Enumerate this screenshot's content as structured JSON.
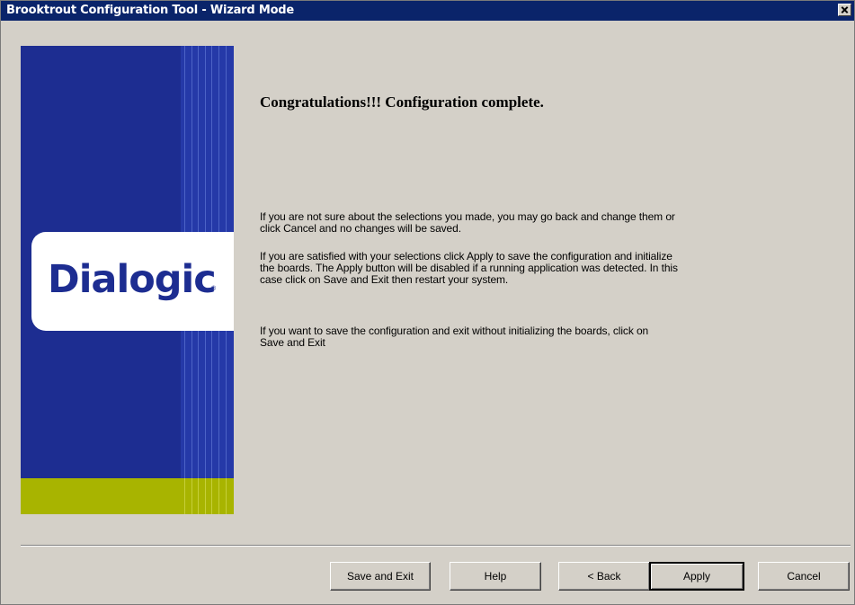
{
  "window": {
    "title": "Brooktrout Configuration Tool - Wizard Mode"
  },
  "brand": {
    "logo_text": "Dialogic",
    "registered_mark": "®"
  },
  "content": {
    "heading": "Congratulations!!! Configuration complete.",
    "paragraphs": [
      "If you are not sure about the selections you made, you may go back and change them or\nclick Cancel and no changes will be saved.",
      "If you are satisfied with your selections click Apply to save the configuration and initialize\nthe boards. The Apply button will be disabled if a running application was detected. In this\ncase click on Save and Exit then restart your system.",
      "If you want to save the configuration and exit without initializing the boards, click on\nSave and Exit"
    ]
  },
  "buttons": {
    "save_exit": "Save and Exit",
    "help": "Help",
    "back": "< Back",
    "apply": "Apply",
    "cancel": "Cancel"
  },
  "colors": {
    "titlebar": "#0a246a",
    "brand_blue": "#1d2d91",
    "brand_green": "#a8b400",
    "dialog_bg": "#d4d0c8"
  }
}
